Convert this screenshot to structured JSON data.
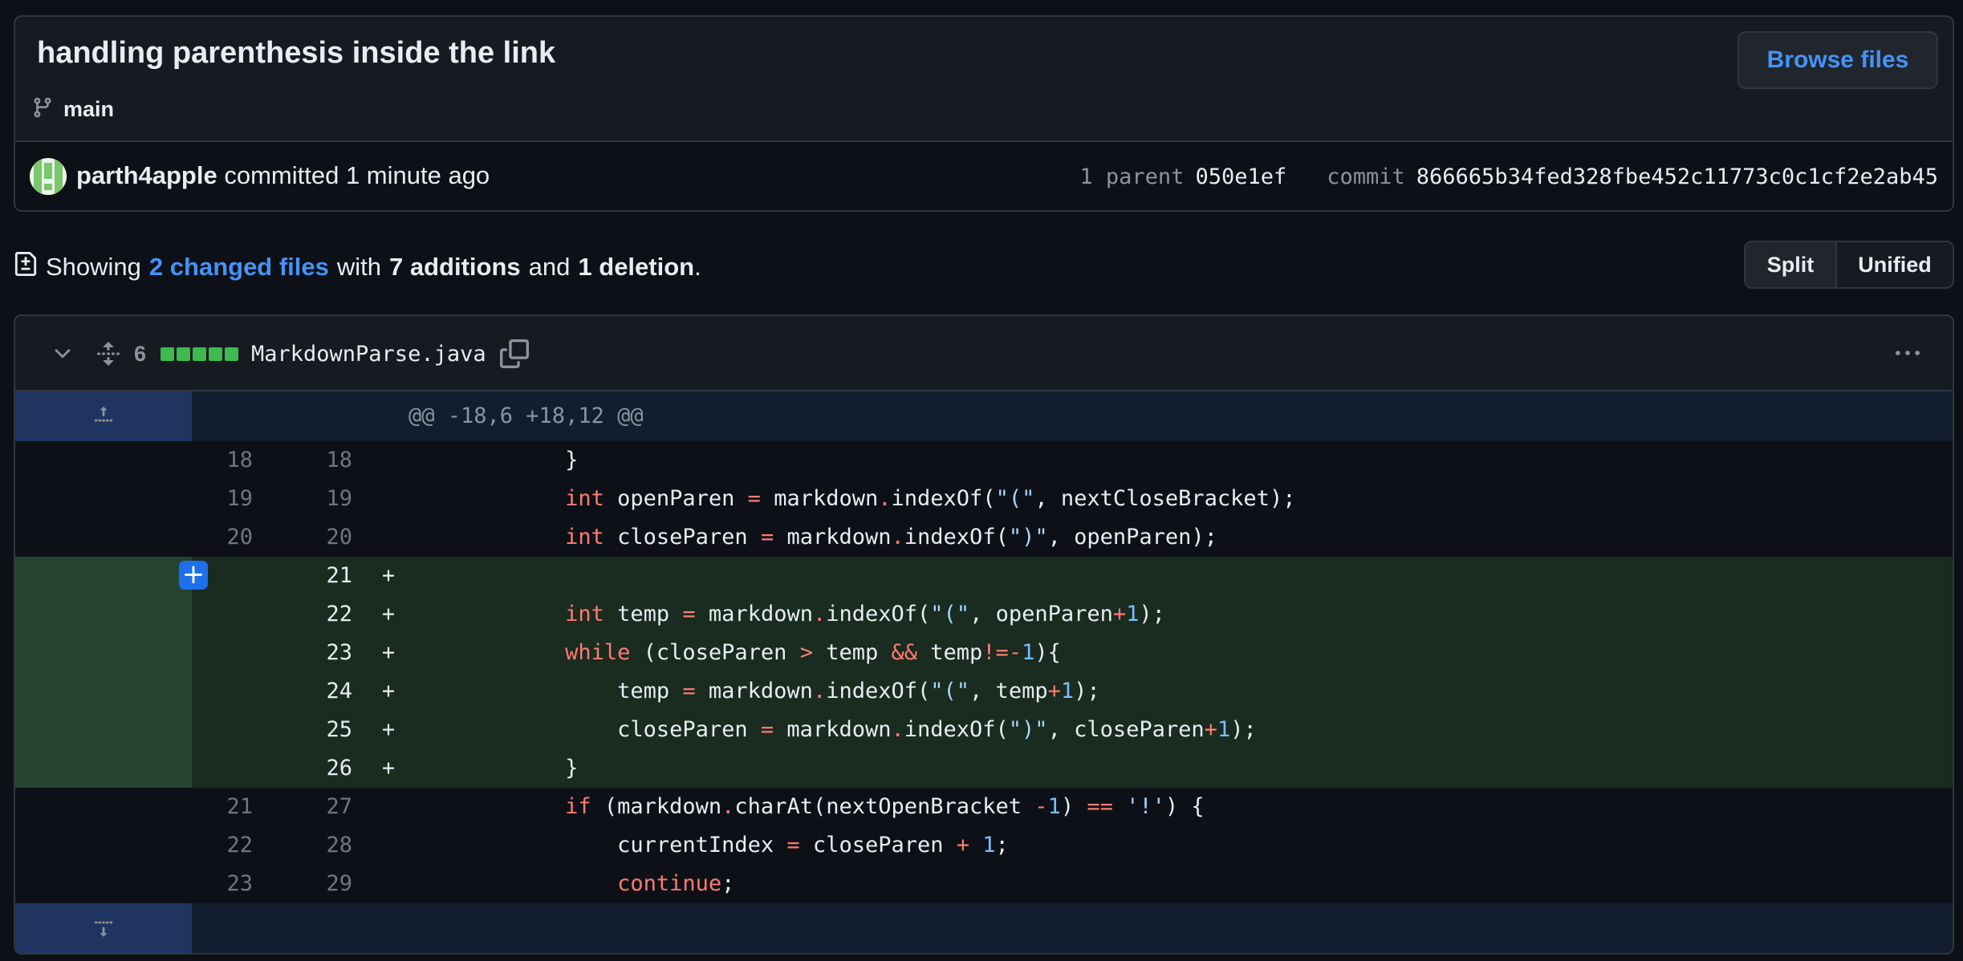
{
  "commit": {
    "title": "handling parenthesis inside the link",
    "branch": "main",
    "browse_label": "Browse files",
    "author": "parth4apple",
    "committed_text": "committed 1 minute ago",
    "parent_label": "1 parent",
    "parent_hash": "050e1ef",
    "commit_label": "commit",
    "commit_hash": "866665b34fed328fbe452c11773c0c1cf2e2ab45"
  },
  "summary": {
    "prefix": "Showing",
    "changed_files": "2 changed files",
    "with": "with",
    "additions": "7 additions",
    "and": "and",
    "deletions": "1 deletion",
    "suffix": "."
  },
  "view": {
    "split": "Split",
    "unified": "Unified",
    "selected": "Split"
  },
  "file": {
    "count": "6",
    "name": "MarkdownParse.java",
    "diffstat": [
      "add",
      "add",
      "add",
      "add",
      "add"
    ],
    "hunk": "@@ -18,6 +18,12 @@",
    "lines": [
      {
        "old": "18",
        "new": "18",
        "type": "ctx",
        "marker": "",
        "code": "            }"
      },
      {
        "old": "19",
        "new": "19",
        "type": "ctx",
        "marker": "",
        "code": "            int openParen = markdown.indexOf(\"(\", nextCloseBracket);"
      },
      {
        "old": "20",
        "new": "20",
        "type": "ctx",
        "marker": "",
        "code": "            int closeParen = markdown.indexOf(\")\", openParen);"
      },
      {
        "old": "",
        "new": "21",
        "type": "add",
        "marker": "+",
        "code": ""
      },
      {
        "old": "",
        "new": "22",
        "type": "add",
        "marker": "+",
        "code": "            int temp = markdown.indexOf(\"(\", openParen+1);"
      },
      {
        "old": "",
        "new": "23",
        "type": "add",
        "marker": "+",
        "code": "            while (closeParen > temp && temp!=-1){"
      },
      {
        "old": "",
        "new": "24",
        "type": "add",
        "marker": "+",
        "code": "                temp = markdown.indexOf(\"(\", temp+1);"
      },
      {
        "old": "",
        "new": "25",
        "type": "add",
        "marker": "+",
        "code": "                closeParen = markdown.indexOf(\")\", closeParen+1);"
      },
      {
        "old": "",
        "new": "26",
        "type": "add",
        "marker": "+",
        "code": "            }"
      },
      {
        "old": "21",
        "new": "27",
        "type": "ctx",
        "marker": "",
        "code": "            if (markdown.charAt(nextOpenBracket -1) == '!') {"
      },
      {
        "old": "22",
        "new": "28",
        "type": "ctx",
        "marker": "",
        "code": "                currentIndex = closeParen + 1;"
      },
      {
        "old": "23",
        "new": "29",
        "type": "ctx",
        "marker": "",
        "code": "                continue;"
      }
    ]
  },
  "colors": {
    "accent": "#4493f8",
    "addition": "#3fb950",
    "keyword": "#ff7b72",
    "string": "#a5d6ff",
    "number": "#79c0ff"
  },
  "icons": [
    "branch-icon",
    "file-diff-icon",
    "chevron-down-icon",
    "unfold-icon",
    "copy-icon",
    "kebab-icon",
    "expand-up-icon",
    "expand-down-icon",
    "plus-icon"
  ]
}
